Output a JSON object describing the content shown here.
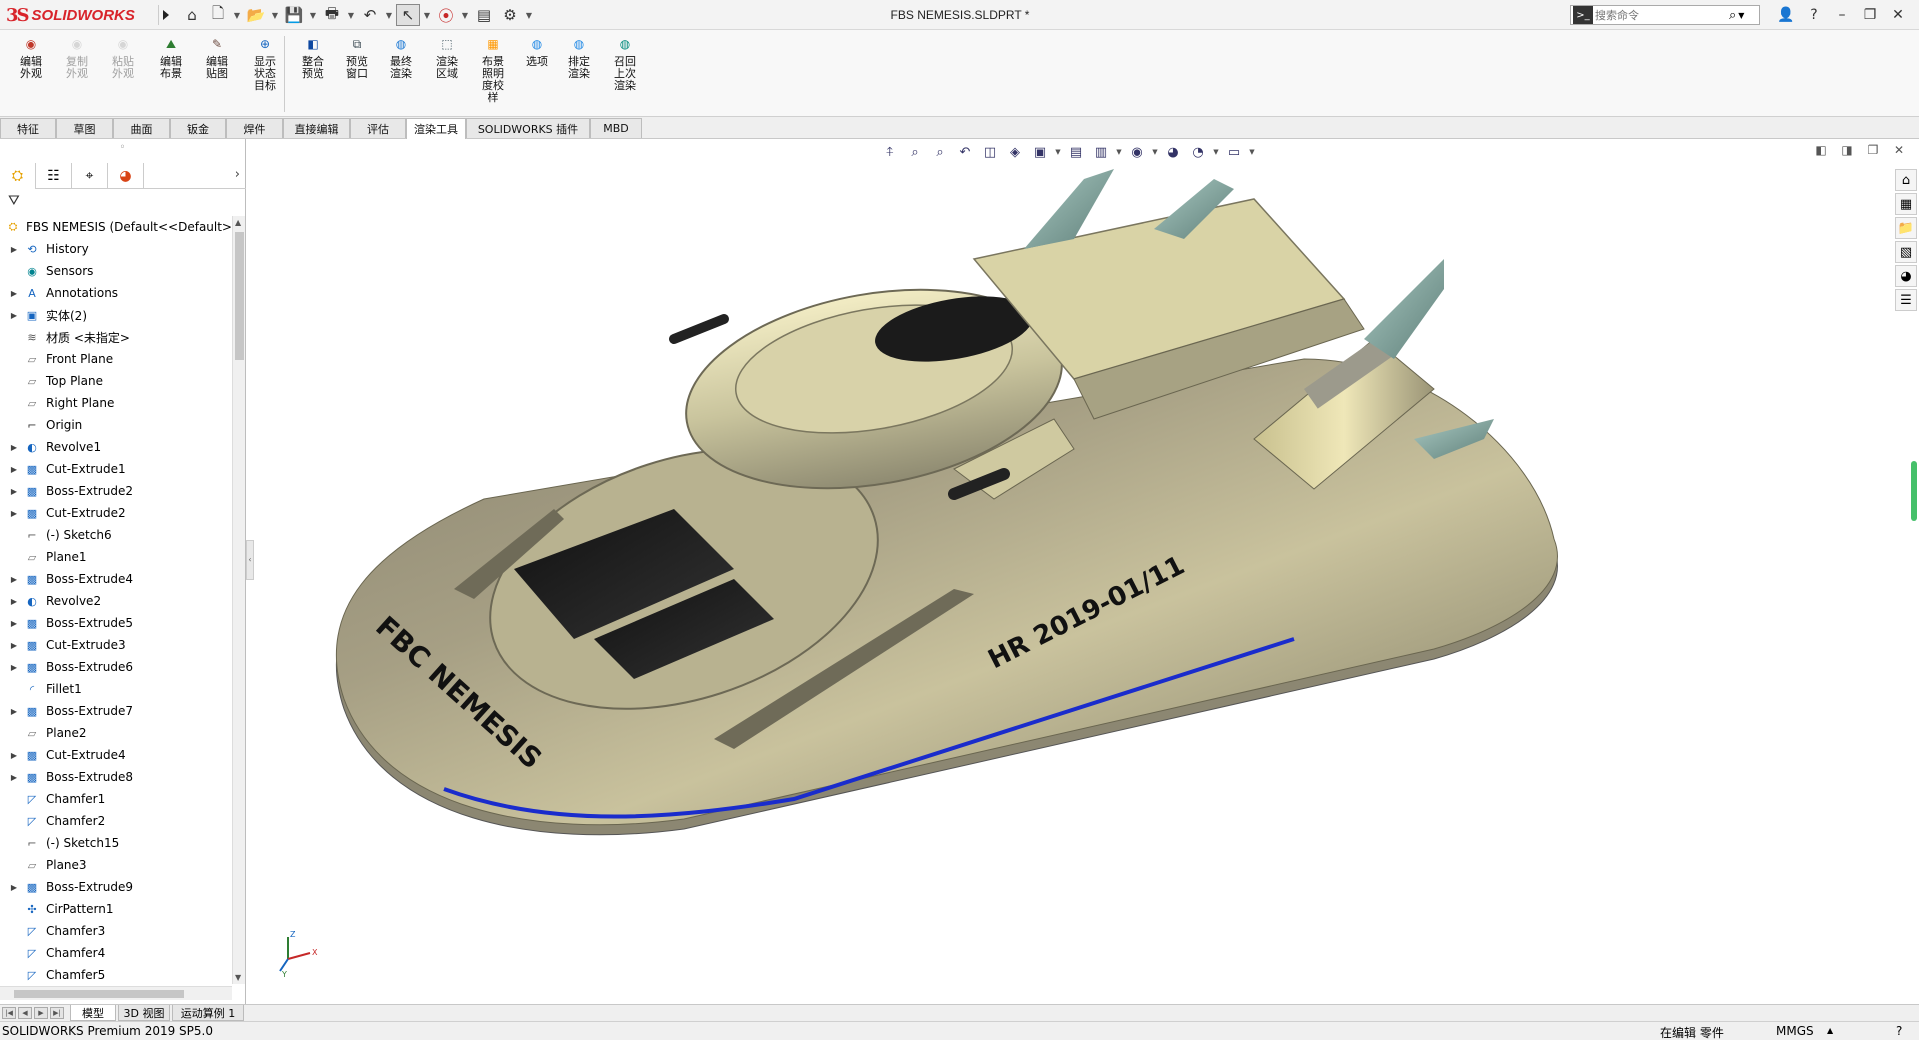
{
  "app": {
    "logo_text": "SOLIDWORKS",
    "doc_title": "FBS NEMESIS.SLDPRT *"
  },
  "search": {
    "placeholder": "搜索命令"
  },
  "quick_tools": [
    "home-icon",
    "new-document-icon",
    "open-icon",
    "save-icon",
    "print-icon",
    "undo-icon",
    "select-icon",
    "traffic-light-icon",
    "file-properties-icon",
    "options-gear-icon"
  ],
  "ribbon": {
    "buttons": [
      {
        "label": "编辑外观",
        "icon": "edit-appearance-icon",
        "enabled": true,
        "color": "#c0392b"
      },
      {
        "label": "复制外观",
        "icon": "copy-appearance-icon",
        "enabled": false,
        "color": "#999999"
      },
      {
        "label": "粘贴外观",
        "icon": "paste-appearance-icon",
        "enabled": false,
        "color": "#999999"
      },
      {
        "label": "编辑布景",
        "icon": "edit-scene-icon",
        "enabled": true,
        "color": "#2e7d32"
      },
      {
        "label": "编辑贴图",
        "icon": "edit-decal-icon",
        "enabled": true,
        "color": "#6d4c41"
      },
      {
        "label": "显示状态目标",
        "icon": "display-state-target-icon",
        "enabled": true,
        "color": "#1565c0"
      },
      {
        "label": "整合预览",
        "icon": "integrated-preview-icon",
        "enabled": true,
        "color": "#0d47a1"
      },
      {
        "label": "预览窗口",
        "icon": "preview-window-icon",
        "enabled": true,
        "color": "#37474f"
      },
      {
        "label": "最终渲染",
        "icon": "final-render-icon",
        "enabled": true,
        "color": "#1976d2"
      },
      {
        "label": "渲染区域",
        "icon": "render-region-icon",
        "enabled": true,
        "color": "#455a64"
      },
      {
        "label": "布景照明度校样",
        "icon": "scene-illumination-proof-icon",
        "enabled": true,
        "color": "#ff9800"
      },
      {
        "label": "选项",
        "icon": "options-icon",
        "enabled": true,
        "color": "#1e88e5"
      },
      {
        "label": "排定渲染",
        "icon": "schedule-render-icon",
        "enabled": true,
        "color": "#1e88e5"
      },
      {
        "label": "召回上次渲染",
        "icon": "recall-last-render-icon",
        "enabled": true,
        "color": "#00897b"
      }
    ]
  },
  "tabs": [
    {
      "label": "特征",
      "active": false
    },
    {
      "label": "草图",
      "active": false
    },
    {
      "label": "曲面",
      "active": false
    },
    {
      "label": "钣金",
      "active": false
    },
    {
      "label": "焊件",
      "active": false
    },
    {
      "label": "直接编辑",
      "active": false
    },
    {
      "label": "评估",
      "active": false
    },
    {
      "label": "渲染工具",
      "active": true
    },
    {
      "label": "SOLIDWORKS 插件",
      "active": false
    },
    {
      "label": "MBD",
      "active": false
    }
  ],
  "panel_tabs": [
    "feature-manager-icon",
    "property-manager-icon",
    "configuration-manager-icon",
    "display-manager-icon"
  ],
  "tree": [
    {
      "label": "FBS NEMESIS  (Default<<Default>",
      "icon": "part-icon",
      "expand": false,
      "root": true
    },
    {
      "label": "History",
      "icon": "history-icon",
      "expand": true
    },
    {
      "label": "Sensors",
      "icon": "sensors-icon",
      "expand": false
    },
    {
      "label": "Annotations",
      "icon": "annotations-icon",
      "expand": true
    },
    {
      "label": "实体(2)",
      "icon": "solid-bodies-icon",
      "expand": true
    },
    {
      "label": "材质 <未指定>",
      "icon": "material-icon",
      "expand": false
    },
    {
      "label": "Front Plane",
      "icon": "plane-icon",
      "expand": false
    },
    {
      "label": "Top Plane",
      "icon": "plane-icon",
      "expand": false
    },
    {
      "label": "Right Plane",
      "icon": "plane-icon",
      "expand": false
    },
    {
      "label": "Origin",
      "icon": "origin-icon",
      "expand": false
    },
    {
      "label": "Revolve1",
      "icon": "revolve-icon",
      "expand": true
    },
    {
      "label": "Cut-Extrude1",
      "icon": "cut-extrude-icon",
      "expand": true
    },
    {
      "label": "Boss-Extrude2",
      "icon": "boss-extrude-icon",
      "expand": true
    },
    {
      "label": "Cut-Extrude2",
      "icon": "cut-extrude-icon",
      "expand": true
    },
    {
      "label": "(-) Sketch6",
      "icon": "sketch-icon",
      "expand": false
    },
    {
      "label": "Plane1",
      "icon": "plane-icon",
      "expand": false
    },
    {
      "label": "Boss-Extrude4",
      "icon": "boss-extrude-icon",
      "expand": true
    },
    {
      "label": "Revolve2",
      "icon": "revolve-icon",
      "expand": true
    },
    {
      "label": "Boss-Extrude5",
      "icon": "boss-extrude-icon",
      "expand": true
    },
    {
      "label": "Cut-Extrude3",
      "icon": "cut-extrude-icon",
      "expand": true
    },
    {
      "label": "Boss-Extrude6",
      "icon": "boss-extrude-icon",
      "expand": true
    },
    {
      "label": "Fillet1",
      "icon": "fillet-icon",
      "expand": false
    },
    {
      "label": "Boss-Extrude7",
      "icon": "boss-extrude-icon",
      "expand": true
    },
    {
      "label": "Plane2",
      "icon": "plane-icon",
      "expand": false
    },
    {
      "label": "Cut-Extrude4",
      "icon": "cut-extrude-icon",
      "expand": true
    },
    {
      "label": "Boss-Extrude8",
      "icon": "boss-extrude-icon",
      "expand": true
    },
    {
      "label": "Chamfer1",
      "icon": "chamfer-icon",
      "expand": false
    },
    {
      "label": "Chamfer2",
      "icon": "chamfer-icon",
      "expand": false
    },
    {
      "label": "(-) Sketch15",
      "icon": "sketch-icon",
      "expand": false
    },
    {
      "label": "Plane3",
      "icon": "plane-icon",
      "expand": false
    },
    {
      "label": "Boss-Extrude9",
      "icon": "boss-extrude-icon",
      "expand": true
    },
    {
      "label": "CirPattern1",
      "icon": "circular-pattern-icon",
      "expand": false
    },
    {
      "label": "Chamfer3",
      "icon": "chamfer-icon",
      "expand": false
    },
    {
      "label": "Chamfer4",
      "icon": "chamfer-icon",
      "expand": false
    },
    {
      "label": "Chamfer5",
      "icon": "chamfer-icon",
      "expand": false
    }
  ],
  "heads_up": [
    "view-orientation-icon",
    "zoom-to-fit-icon",
    "zoom-to-area-icon",
    "previous-view-icon",
    "section-view-icon",
    "dynamic-annotation-icon",
    "3d-view-icon",
    "view-orientation-dd-icon",
    "display-style-icon",
    "hide-show-icon",
    "edit-appearance-icon",
    "apply-scene-icon",
    "view-settings-icon"
  ],
  "viewport_controls": [
    "restore-icon",
    "tile-icon",
    "maximize-icon",
    "close-icon"
  ],
  "task_pane": [
    "solidworks-resources-icon",
    "design-library-icon",
    "file-explorer-icon",
    "view-palette-icon",
    "appearances-icon",
    "custom-properties-icon"
  ],
  "model": {
    "label_left": "FBC NEMESIS",
    "label_right": "HR 2019-01/11"
  },
  "triad": {
    "x": "X",
    "y": "Y",
    "z": "Z"
  },
  "bottom_tabs": [
    {
      "label": "模型",
      "active": true
    },
    {
      "label": "3D 视图",
      "active": false
    },
    {
      "label": "运动算例 1",
      "active": false
    }
  ],
  "status": {
    "product": "SOLIDWORKS Premium 2019 SP5.0",
    "edit_state": "在编辑 零件",
    "units": "MMGS",
    "help": "?"
  }
}
